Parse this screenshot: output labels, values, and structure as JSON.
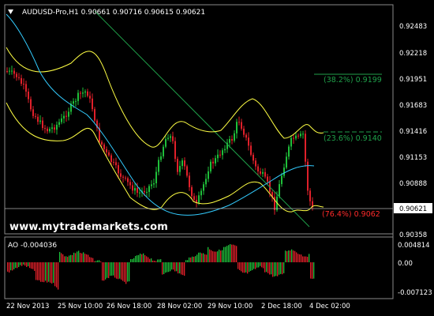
{
  "header": {
    "symbol_line": "AUDUSD-Pro,H1  0.90661 0.90716 0.90615 0.90621",
    "oscillator_line": "AO -0.004036"
  },
  "watermark": "www.mytrademarkets.com",
  "price_axis": [
    "0.92483",
    "0.92218",
    "0.91951",
    "0.91683",
    "0.91416",
    "0.91153",
    "0.90888",
    "0.90621",
    "0.90358"
  ],
  "current_price_label": "0.90621",
  "ao_axis": [
    "0.004814",
    "0.00",
    "-0.007123"
  ],
  "time_axis": [
    "22 Nov 2013",
    "25 Nov 10:00",
    "26 Nov 18:00",
    "28 Nov 02:00",
    "29 Nov 10:00",
    "2 Dec 18:00",
    "4 Dec 02:00"
  ],
  "fib_levels": [
    {
      "label": "(38.2%) 0.9199",
      "value": 0.9199,
      "color": "#1fa14a"
    },
    {
      "label": "(23.6%) 0.9140",
      "value": 0.914,
      "color": "#1fa14a"
    },
    {
      "label": "(76.4%) 0.9062",
      "value": 0.9062,
      "color": "#ff2a2a"
    }
  ],
  "colors": {
    "background": "#000000",
    "bull_candle": "#1fbf3a",
    "bear_candle": "#e0202a",
    "bollinger": "#ffff44",
    "moving_average": "#33ccff",
    "trendline": "#1fa14a",
    "ao_up": "#1fbf3a",
    "ao_down": "#e0202a"
  }
}
